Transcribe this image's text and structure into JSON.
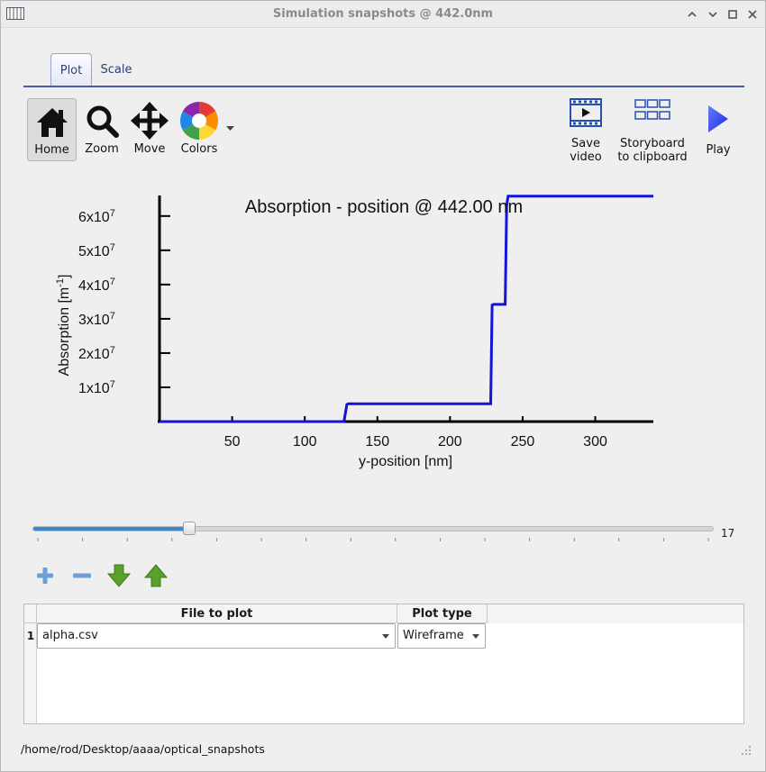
{
  "window": {
    "title": "Simulation snapshots @ 442.0nm",
    "controls": [
      "‸",
      "⌄",
      "◻",
      "✕"
    ]
  },
  "tabs": [
    {
      "label": "Plot",
      "active": true
    },
    {
      "label": "Scale",
      "active": false
    }
  ],
  "toolbar": {
    "home_label": "Home",
    "zoom_label": "Zoom",
    "move_label": "Move",
    "colors_label": "Colors",
    "save_video_label": "Save\nvideo",
    "save_video_line1": "Save",
    "save_video_line2": "video",
    "storyboard_line1": "Storyboard",
    "storyboard_line2": "to clipboard",
    "play_label": "Play"
  },
  "chart_data": {
    "type": "line",
    "title": "Absorption - position @ 442.00 nm",
    "xlabel": "y-position [nm]",
    "ylabel_base": "Absorption [m",
    "ylabel_sup": "-1",
    "ylabel_end": "]",
    "xlim": [
      0,
      340
    ],
    "ylim": [
      0,
      66000000.0
    ],
    "xticks": [
      50,
      100,
      150,
      200,
      250,
      300
    ],
    "yticks": [
      {
        "value": 10000000.0,
        "mant": "1x10",
        "exp": "7"
      },
      {
        "value": 20000000.0,
        "mant": "2x10",
        "exp": "7"
      },
      {
        "value": 30000000.0,
        "mant": "3x10",
        "exp": "7"
      },
      {
        "value": 40000000.0,
        "mant": "4x10",
        "exp": "7"
      },
      {
        "value": 50000000.0,
        "mant": "5x10",
        "exp": "7"
      },
      {
        "value": 60000000.0,
        "mant": "6x10",
        "exp": "7"
      }
    ],
    "color": "#1414d8",
    "series": [
      {
        "x": [
          0,
          127,
          129,
          130,
          228,
          229,
          230,
          238,
          239,
          240,
          340
        ],
        "y": [
          0,
          0,
          5000000.0,
          5200000.0,
          5200000.0,
          34000000.0,
          34200000.0,
          34200000.0,
          63000000.0,
          65800000.0,
          65800000.0
        ]
      }
    ]
  },
  "slider": {
    "value": 17,
    "value_label": "17",
    "fraction": 0.23,
    "ticks": 16
  },
  "table": {
    "headers": {
      "file": "File to plot",
      "type": "Plot type"
    },
    "rows": [
      {
        "num": "1",
        "file": "alpha.csv",
        "type": "Wireframe"
      }
    ]
  },
  "status": {
    "path": "/home/rod/Desktop/aaaa/optical_snapshots"
  }
}
